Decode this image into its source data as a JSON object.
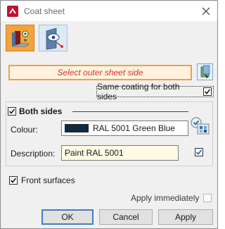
{
  "window": {
    "title": "Coat sheet"
  },
  "toolbar": {
    "mode_buttons": [
      "coat-outer-side-icon",
      "coat-visible-side-icon"
    ]
  },
  "prompt": {
    "text": "Select outer sheet side"
  },
  "same_coating": {
    "label": "Same coating for both sides",
    "checked": true
  },
  "group": {
    "label": "Both sides",
    "checked": true,
    "colour_label": "Colour:",
    "colour_value": "RAL 5001 Green Blue",
    "colour_swatch": "#0f2a44",
    "description_label": "Description:",
    "description_value": "Paint RAL 5001",
    "description_checked": true
  },
  "front_surfaces": {
    "label": "Front surfaces",
    "checked": true
  },
  "apply_immediately": {
    "label": "Apply immediately",
    "checked": false
  },
  "buttons": {
    "ok": "OK",
    "cancel": "Cancel",
    "apply": "Apply"
  },
  "colors": {
    "accent_orange": "#f5a23c",
    "prompt_red": "#d8342a",
    "check_blue": "#1c5fa8"
  }
}
